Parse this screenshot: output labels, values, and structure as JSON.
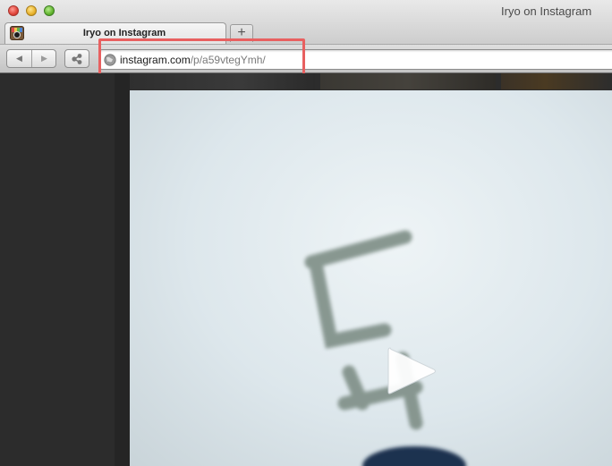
{
  "window": {
    "title": "Iryo on Instagram"
  },
  "tabs": [
    {
      "label": "Iryo on Instagram",
      "icon": "instagram-favicon-icon"
    }
  ],
  "toolbar": {
    "back_icon": "back-arrow-icon",
    "forward_icon": "forward-arrow-icon",
    "share_icon": "share-icon",
    "new_tab_label": "+"
  },
  "address_bar": {
    "host": "instagram.com",
    "path": "/p/a59vtegYmh/",
    "icon": "globe-icon",
    "highlight_color": "#e86060"
  },
  "media": {
    "overlay_icon": "play-icon"
  }
}
